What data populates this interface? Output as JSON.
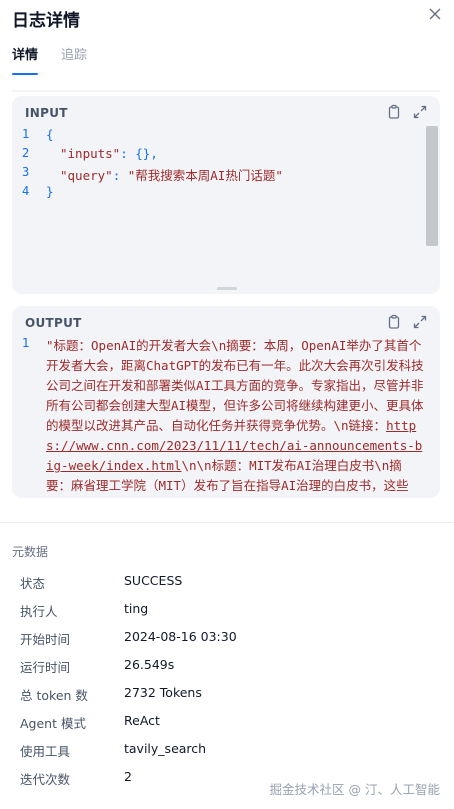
{
  "header": {
    "title": "日志详情",
    "close_icon": "close-icon"
  },
  "tabs": [
    {
      "label": "详情",
      "active": true
    },
    {
      "label": "追踪",
      "active": false
    }
  ],
  "input": {
    "title": "INPUT",
    "line_numbers": [
      "1",
      "2",
      "3",
      "4"
    ],
    "lines": {
      "l1": "{",
      "l2_key": "\"inputs\"",
      "l2_rest": ": {},",
      "l3_key": "\"query\"",
      "l3_colon": ": ",
      "l3_val": "\"帮我搜索本周AI热门话题\"",
      "l4": "}"
    }
  },
  "output": {
    "title": "OUTPUT",
    "line_number": "1",
    "text_before_link": "\"标题：OpenAI的开发者大会\\n摘要：本周，OpenAI举办了其首个开发者大会，距离ChatGPT的发布已有一年。此次大会再次引发科技公司之间在开发和部署类似AI工具方面的竞争。专家指出，尽管并非所有公司都会创建大型AI模型，但许多公司将继续构建更小、更具体的模型以改进其产品、自动化任务并获得竞争优势。\\n链接：",
    "link": "https://www.cnn.com/2023/11/11/tech/ai-announcements-big-week/index.html",
    "text_after_link": "\\n\\n标题：MIT发布AI治理白皮书\\n摘要：麻省理工学院（MIT）发布了旨在指导AI治理的白皮书，这些"
  },
  "metadata": {
    "title": "元数据",
    "rows": [
      {
        "label": "状态",
        "value": "SUCCESS"
      },
      {
        "label": "执行人",
        "value": "ting"
      },
      {
        "label": "开始时间",
        "value": "2024-08-16 03:30"
      },
      {
        "label": "运行时间",
        "value": "26.549s"
      },
      {
        "label": "总 token 数",
        "value": "2732 Tokens"
      },
      {
        "label": "Agent 模式",
        "value": "ReAct"
      },
      {
        "label": "使用工具",
        "value": "tavily_search"
      },
      {
        "label": "迭代次数",
        "value": "2"
      }
    ]
  },
  "watermark": "掘金技术社区 @ 汀、人工智能",
  "colors": {
    "accent": "#1570ef",
    "code_string": "#9e2a2b",
    "panel_bg": "#f2f4f7"
  }
}
